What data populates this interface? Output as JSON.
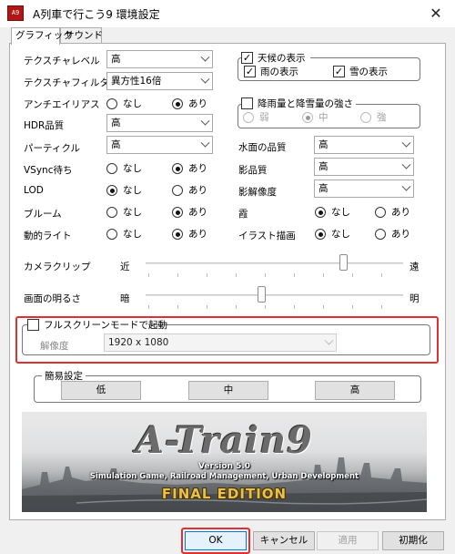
{
  "window": {
    "title": "A列車で行こう9 環境設定",
    "close_symbol": "✕",
    "app_icon_text": "A9"
  },
  "tabs": [
    {
      "label": "グラフィック",
      "active": true
    },
    {
      "label": "サウンド",
      "active": false
    }
  ],
  "texture_level": {
    "label": "テクスチャレベル",
    "value": "高"
  },
  "texture_filter": {
    "label": "テクスチャフィルター",
    "value": "異方性16倍"
  },
  "antialias": {
    "label": "アンチエイリアス",
    "options": [
      "なし",
      "あり"
    ],
    "selected": "あり"
  },
  "hdr": {
    "label": "HDR品質",
    "value": "高"
  },
  "particle": {
    "label": "パーティクル",
    "value": "高"
  },
  "vsync": {
    "label": "VSync待ち",
    "options": [
      "なし",
      "あり"
    ],
    "selected": "あり"
  },
  "lod": {
    "label": "LOD",
    "options": [
      "なし",
      "あり"
    ],
    "selected": "なし"
  },
  "bloom": {
    "label": "ブルーム",
    "options": [
      "なし",
      "あり"
    ],
    "selected": "あり"
  },
  "dynamic_light": {
    "label": "動的ライト",
    "options": [
      "なし",
      "あり"
    ],
    "selected": "あり"
  },
  "weather": {
    "label": "天候の表示",
    "checked": true,
    "rain": {
      "label": "雨の表示",
      "checked": true
    },
    "snow": {
      "label": "雪の表示",
      "checked": true
    },
    "check_mark": "✓"
  },
  "precipitation": {
    "label": "降雨量と降雪量の強さ",
    "checked": false,
    "options": [
      "弱",
      "中",
      "強"
    ],
    "selected": "中"
  },
  "water_quality": {
    "label": "水面の品質",
    "value": "高"
  },
  "shadow_quality": {
    "label": "影品質",
    "value": "高"
  },
  "shadow_resolution": {
    "label": "影解像度",
    "value": "高"
  },
  "fog": {
    "label": "霞",
    "options": [
      "なし",
      "あり"
    ],
    "selected": "なし"
  },
  "illustration": {
    "label": "イラスト描画",
    "options": [
      "なし",
      "あり"
    ],
    "selected": "なし"
  },
  "camera_clip": {
    "label": "カメラクリップ",
    "min_label": "近",
    "max_label": "遠",
    "value_fraction": 0.77
  },
  "brightness": {
    "label": "画面の明るさ",
    "min_label": "暗",
    "max_label": "明",
    "value_fraction": 0.45
  },
  "fullscreen": {
    "label": "フルスクリーンモードで起動",
    "checked": false,
    "resolution_label": "解像度",
    "resolution_value": "1920 x 1080"
  },
  "quick_settings": {
    "label": "簡易設定",
    "buttons": [
      "低",
      "中",
      "高"
    ]
  },
  "banner": {
    "logo": "A-Train9",
    "version": "Version 5.0",
    "subtitle": "Simulation Game, Railroad Management, Urban Development",
    "edition": "FINAL EDITION"
  },
  "footer": {
    "ok": "OK",
    "cancel": "キャンセル",
    "apply": "適用",
    "reset": "初期化"
  },
  "colors": {
    "highlight": "#e03030",
    "edition_gold": "#e8c04a"
  }
}
